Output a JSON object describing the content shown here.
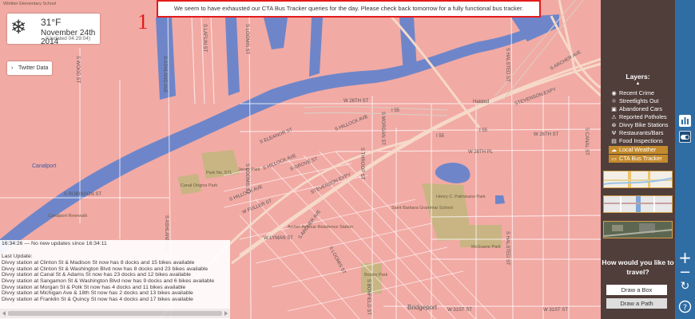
{
  "weather": {
    "icon": "snowflake-icon",
    "temperature": "31°F",
    "date": "November 24th 2014",
    "updated": "(Updated 04:29:04)"
  },
  "twitter": {
    "label": "Twitter Data"
  },
  "alert": {
    "message": "We seem to have exhausted our CTA Bus Tracker queries for the day. Please check back tomorrow for a fully functional bus tracker.",
    "annotation_number": "1"
  },
  "map": {
    "street_labels": [
      "S ASHLAND AVE",
      "S LOOMIS ST",
      "S ARCHER AVE",
      "W 26TH ST",
      "S HALSTED ST",
      "STEVENSON EXPY",
      "I 55",
      "W 31ST ST",
      "W 28TH PL",
      "S THROOP ST",
      "S BONFIELD ST",
      "W LYMAN ST",
      "S ELEANOR ST",
      "S HILLOCK AVE",
      "S GROVE ST",
      "W FULLER ST",
      "S ROBINSON ST",
      "S LAFLIN ST",
      "S WOOD ST",
      "S MORGAN ST",
      "S CANAL ST",
      "Halsted",
      "Bridgeport"
    ],
    "place_labels": [
      "Canal Origins Park",
      "Park No. 571",
      "Jacob Park",
      "Henry C. Palmisano Park",
      "McGuane Park",
      "Bosley Park",
      "Saint Barbara Grammar School",
      "Archer Avenue Residence Station",
      "Canalport",
      "Canalport Riverwalk",
      "Whittier Elementary School"
    ]
  },
  "log": {
    "status": "16:34:26 — No new updates since 16:34:11",
    "last_update_label": "Last Update:",
    "lines": [
      "Divvy station at Clinton St & Madison St now has 8 docks and 15 bikes available",
      "Divvy station at Clinton St & Washington Blvd now has 8 docks and 23 bikes available",
      "Divvy station at Canal St & Adams St now has 23 docks and 12 bikes available",
      "Divvy station at Sangamon St & Washington Blvd now has 9 docks and 6 bikes available",
      "Divvy station at Morgan St & Polk St now has 4 docks and 11 bikes available",
      "Divvy station at Michigan Ave & 18th St now has 2 docks and 13 bikes available",
      "Divvy station at Franklin St & Quincy St now has 4 docks and 17 bikes available"
    ]
  },
  "sidebar": {
    "title": "Layers:",
    "layers": [
      {
        "label": "Recent Crime",
        "icon": "shield-icon",
        "active": false
      },
      {
        "label": "Streetlights Out",
        "icon": "bulb-icon",
        "active": false
      },
      {
        "label": "Abandoned Cars",
        "icon": "car-icon",
        "active": false
      },
      {
        "label": "Reported Potholes",
        "icon": "warning-icon",
        "active": false
      },
      {
        "label": "Divvy Bike Stations",
        "icon": "bike-icon",
        "active": false
      },
      {
        "label": "Restaurants/Bars",
        "icon": "fork-icon",
        "active": false
      },
      {
        "label": "Food Inspections",
        "icon": "clipboard-icon",
        "active": false
      },
      {
        "label": "Local Weather",
        "icon": "cloud-icon",
        "active": true
      },
      {
        "label": "CTA Bus Tracker",
        "icon": "bus-icon",
        "active": true
      }
    ],
    "travel_question": "How would you like to travel?",
    "draw_box": "Draw a Box",
    "draw_path": "Draw a Path"
  },
  "colors": {
    "accent": "#c48a2b",
    "alert_border": "#e31b1b",
    "sidebar": "#503e3b",
    "strip": "#2f6da5",
    "canal": "#5a7ec6",
    "overlay": "#f2a9a4"
  }
}
